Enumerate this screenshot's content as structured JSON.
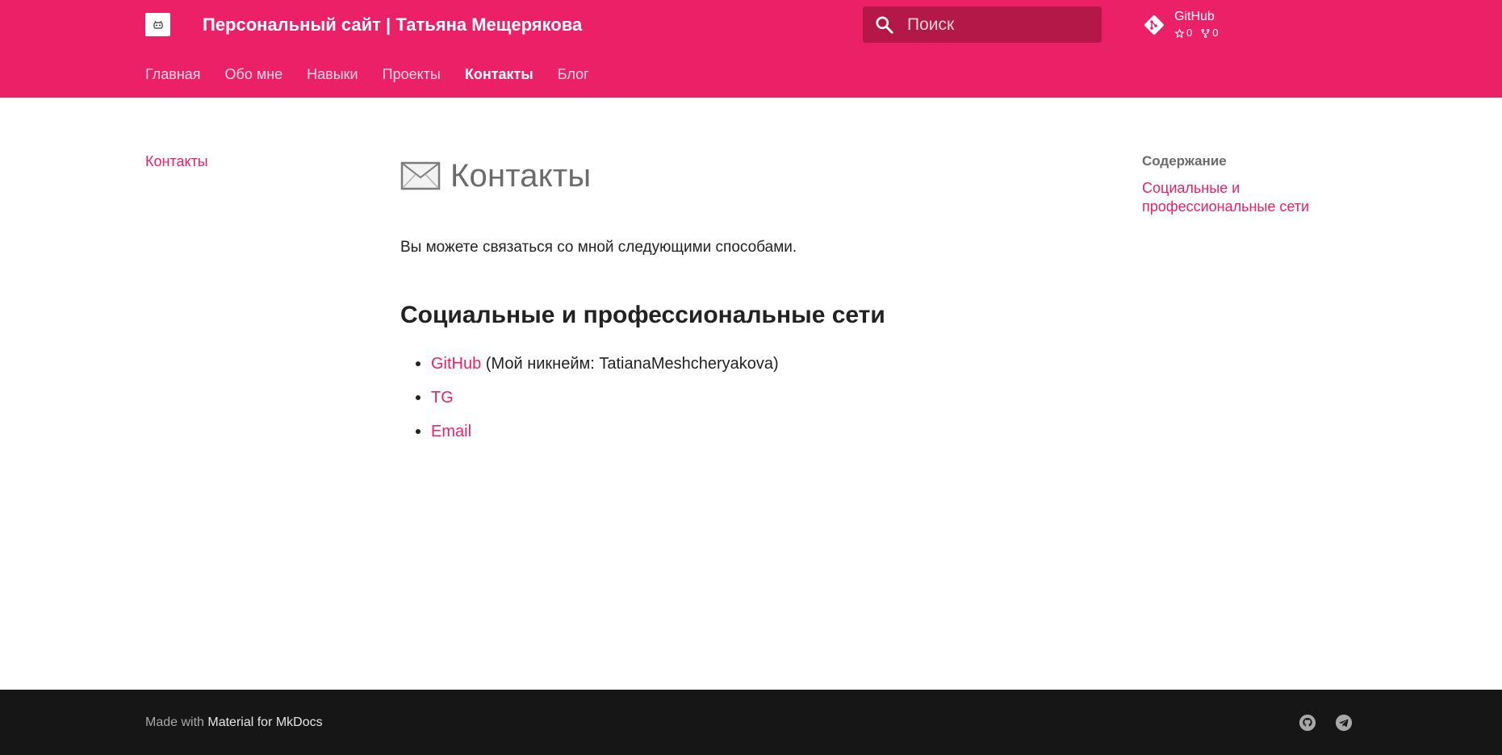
{
  "header": {
    "site_title": "Персональный сайт | Татьяна Мещерякова",
    "search": {
      "placeholder": "Поиск",
      "value": ""
    },
    "repo": {
      "name": "GitHub",
      "stars": "0",
      "forks": "0"
    },
    "tabs": [
      {
        "label": "Главная"
      },
      {
        "label": "Обо мне"
      },
      {
        "label": "Навыки"
      },
      {
        "label": "Проекты"
      },
      {
        "label": "Контакты",
        "active": true
      },
      {
        "label": "Блог"
      }
    ]
  },
  "left_nav": {
    "current": "Контакты"
  },
  "content": {
    "title": "Контакты",
    "intro": "Вы можете связаться со мной следующими способами.",
    "section_heading": "Социальные и профессиональные сети",
    "links": [
      {
        "label": "GitHub",
        "note": " (Мой никнейм: TatianaMeshcheryakova)"
      },
      {
        "label": "TG",
        "note": ""
      },
      {
        "label": "Email",
        "note": ""
      }
    ]
  },
  "toc": {
    "title": "Содержание",
    "items": [
      {
        "label": "Социальные и профессиональные сети"
      }
    ]
  },
  "footer": {
    "made_with_prefix": "Made with ",
    "made_with_link": "Material for MkDocs",
    "social_icons": [
      "github-icon",
      "telegram-icon"
    ]
  },
  "colors": {
    "primary": "#ec2066",
    "search_bg": "#b31849",
    "footer_bg": "#161616"
  }
}
